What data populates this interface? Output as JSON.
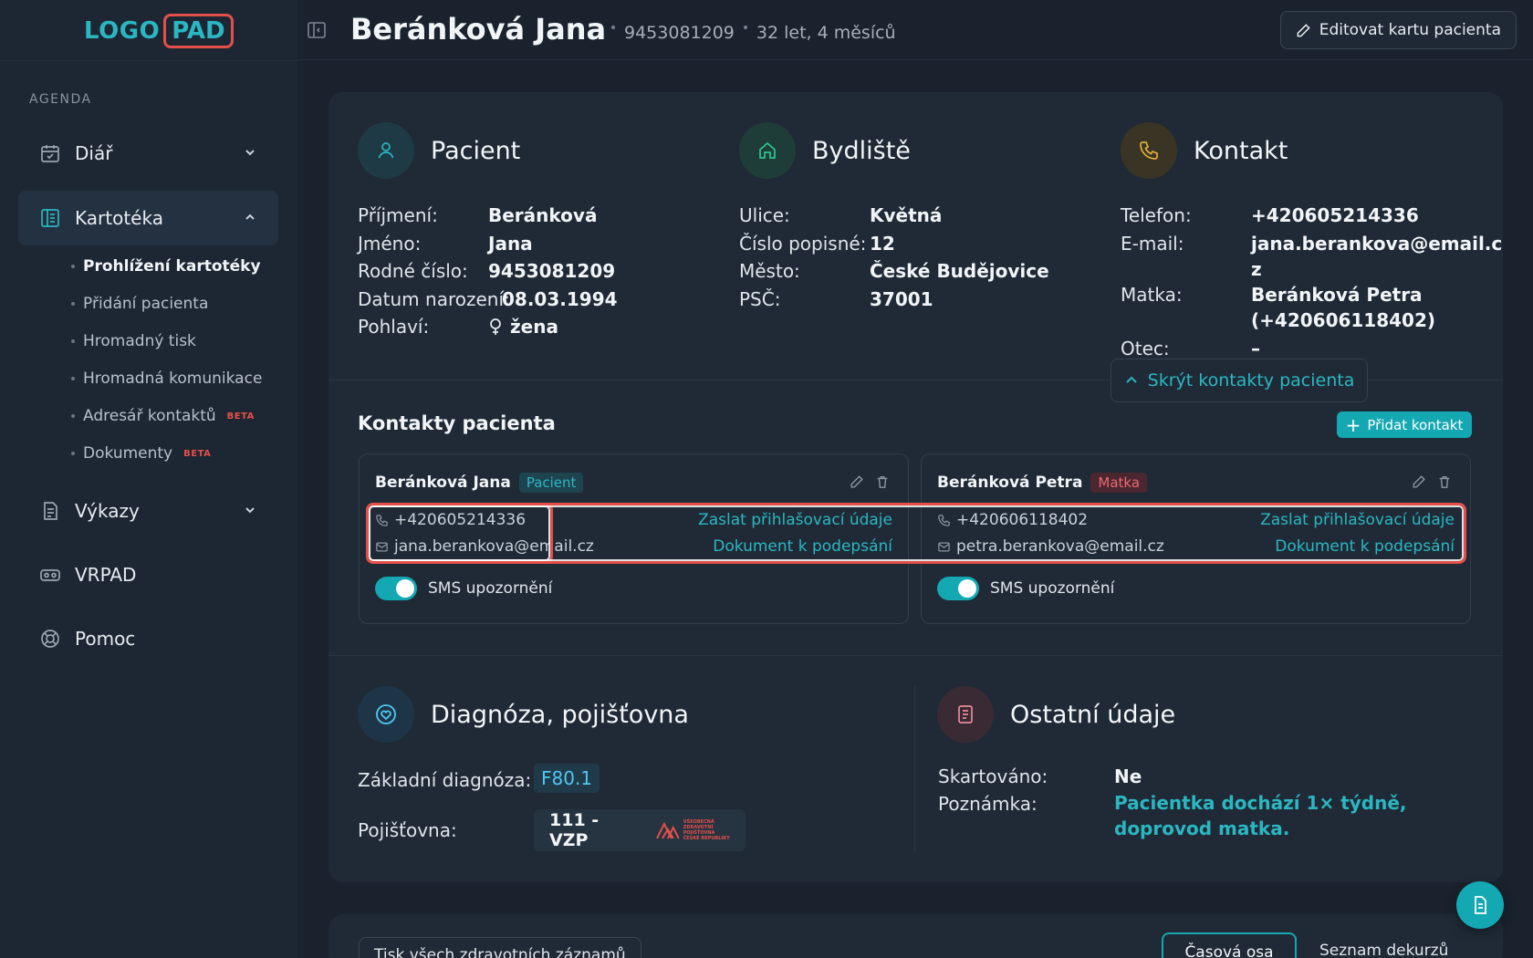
{
  "logo": {
    "part1": "LOGO",
    "part2": "PAD"
  },
  "sidebar": {
    "section_label": "AGENDA",
    "items": [
      {
        "label": "Diář",
        "icon": "calendar-icon"
      },
      {
        "label": "Kartotéka",
        "icon": "book-icon",
        "active": true
      },
      {
        "label": "Výkazy",
        "icon": "report-icon"
      },
      {
        "label": "VRPAD",
        "icon": "vr-headset-icon"
      },
      {
        "label": "Pomoc",
        "icon": "lifebuoy-icon"
      }
    ],
    "subitems": [
      {
        "label": "Prohlížení kartotéky",
        "active": true
      },
      {
        "label": "Přidání pacienta"
      },
      {
        "label": "Hromadný tisk"
      },
      {
        "label": "Hromadná komunikace"
      },
      {
        "label": "Adresář kontaktů",
        "badge": "BETA"
      },
      {
        "label": "Dokumenty",
        "badge": "BETA"
      }
    ]
  },
  "header": {
    "name": "Beránková Jana",
    "birth_number": "9453081209",
    "age": "32 let, 4 měsíců",
    "edit_label": "Editovat kartu pacienta"
  },
  "patient": {
    "title": "Pacient",
    "fields": [
      {
        "k": "Příjmení:",
        "v": "Beránková"
      },
      {
        "k": "Jméno:",
        "v": "Jana"
      },
      {
        "k": "Rodné číslo:",
        "v": "9453081209"
      },
      {
        "k": "Datum narození:",
        "v": "08.03.1994"
      },
      {
        "k": "Pohlaví:",
        "v": "žena"
      }
    ]
  },
  "residence": {
    "title": "Bydliště",
    "fields": [
      {
        "k": "Ulice:",
        "v": "Květná"
      },
      {
        "k": "Číslo popisné:",
        "v": "12"
      },
      {
        "k": "Město:",
        "v": "České Budějovice"
      },
      {
        "k": "PSČ:",
        "v": "37001"
      }
    ]
  },
  "contact": {
    "title": "Kontakt",
    "phone_label": "Telefon:",
    "phone": "+420605214336",
    "email_label": "E-mail:",
    "email_line1": "jana.berankova@email.c",
    "email_line2": "z",
    "mother_label": "Matka:",
    "mother_line1": "Beránková Petra",
    "mother_line2": "(+420606118402)",
    "father_label": "Otec:",
    "father": "–",
    "hide_label": "Skrýt kontakty pacienta"
  },
  "contacts_section": {
    "title": "Kontakty pacienta",
    "add_label": "Přidat kontakt",
    "cards": [
      {
        "name": "Beránková Jana",
        "role": "Pacient",
        "phone": "+420605214336",
        "email": "jana.berankova@email.cz",
        "send_login": "Zaslat přihlašovací údaje",
        "sign_doc": "Dokument k podepsání",
        "sms_label": "SMS upozornění",
        "sms_on": true
      },
      {
        "name": "Beránková Petra",
        "role": "Matka",
        "phone": "+420606118402",
        "email": "petra.berankova@email.cz",
        "send_login": "Zaslat přihlašovací údaje",
        "sign_doc": "Dokument k podepsání",
        "sms_label": "SMS upozornění",
        "sms_on": true
      }
    ]
  },
  "diagnosis": {
    "title": "Diagnóza, pojišťovna",
    "base_label": "Základní diagnóza:",
    "base_value": "F80.1",
    "insurer_label": "Pojišťovna:",
    "insurer_value": "111 - VZP",
    "insurer_logo_text": [
      "VŠEOBECNÁ",
      "ZDRAVOTNÍ POJIŠŤOVNA",
      "ČESKÉ REPUBLIKY"
    ]
  },
  "other": {
    "title": "Ostatní údaje",
    "shredded_label": "Skartováno:",
    "shredded_value": "Ne",
    "note_label": "Poznámka:",
    "note_value": "Pacientka dochází 1× týdně, doprovod matka."
  },
  "bottom": {
    "print_all": "Tisk všech zdravotních záznamů",
    "timeline": "Časová osa",
    "decursus_list": "Seznam dekurzů"
  },
  "colors": {
    "accent": "#14a8b3",
    "accent_text": "#2bb7c2",
    "highlight": "#e3504a",
    "background": "#19222d",
    "card": "#1f2a36"
  }
}
